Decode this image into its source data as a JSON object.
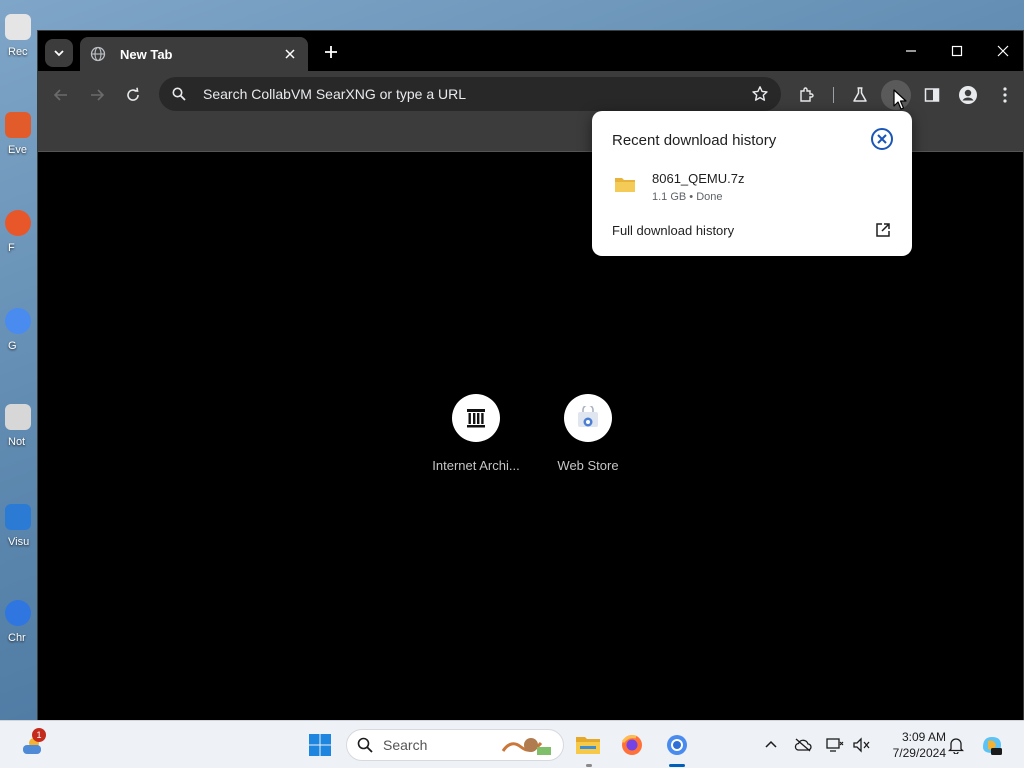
{
  "desktop": {
    "icons": [
      {
        "label": "Rec",
        "color": "#e5e5e5"
      },
      {
        "label": "Eve",
        "color": "#e25b2a"
      },
      {
        "label": "F",
        "color": "#e8572a"
      },
      {
        "label": "G",
        "color": "#4a8bef"
      },
      {
        "label": "Not",
        "color": "#d7d7d7"
      },
      {
        "label": "Visu",
        "color": "#2b7bd4"
      },
      {
        "label": "Chr",
        "color": "#2f76e0"
      }
    ]
  },
  "browser": {
    "tab": {
      "title": "New Tab"
    },
    "omnibox": {
      "text": "Search CollabVM SearXNG or type a URL"
    },
    "shortcuts": [
      {
        "name": "Internet Archi..."
      },
      {
        "name": "Web Store"
      }
    ]
  },
  "download_panel": {
    "title": "Recent download history",
    "item": {
      "filename": "8061_QEMU.7z",
      "meta": "1.1 GB • Done"
    },
    "full_history_label": "Full download history"
  },
  "taskbar": {
    "search_label": "Search",
    "notification_count": "1",
    "time": "3:09 AM",
    "date": "7/29/2024"
  },
  "colors": {
    "accent": "#1a73e8",
    "taskbar_active": "#005fb8"
  }
}
